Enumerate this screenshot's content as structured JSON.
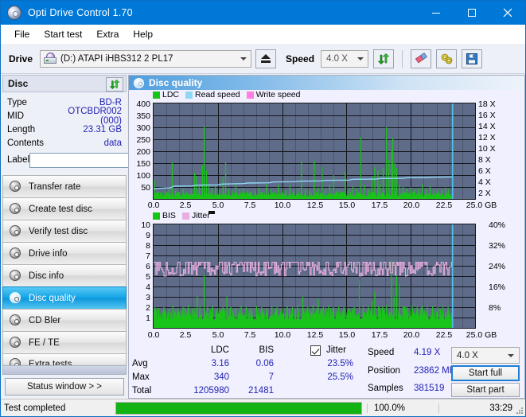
{
  "window": {
    "title": "Opti Drive Control 1.70",
    "icon": "disc-icon",
    "minimize": "minimize-icon",
    "maximize": "maximize-icon",
    "close": "close-icon"
  },
  "menubar": {
    "items": [
      {
        "label": "File"
      },
      {
        "label": "Start test"
      },
      {
        "label": "Extra"
      },
      {
        "label": "Help"
      }
    ]
  },
  "toolbar": {
    "drive_label": "Drive",
    "drive_value": "(D:)   ATAPI iHBS312   2 PL17",
    "eject_icon": "eject-icon",
    "speed_label": "Speed",
    "speed_value": "4.0 X",
    "refresh_icon": "refresh-icon",
    "eraser_icon": "eraser-icon",
    "settings_icon": "wrench-icon",
    "save_icon": "save-icon"
  },
  "disc_panel": {
    "title": "Disc",
    "refresh_icon": "refresh-icon",
    "fields": [
      {
        "key": "Type",
        "value": "BD-R"
      },
      {
        "key": "MID",
        "value": "OTCBDR002 (000)"
      },
      {
        "key": "Length",
        "value": "23.31 GB"
      },
      {
        "key": "Contents",
        "value": "data"
      }
    ],
    "label_key": "Label",
    "label_value": "",
    "label_button_icon": "cd-icon"
  },
  "nav": {
    "items": [
      {
        "label": "Transfer rate",
        "icon": "disc-transfer-icon",
        "active": false
      },
      {
        "label": "Create test disc",
        "icon": "disc-create-icon",
        "active": false
      },
      {
        "label": "Verify test disc",
        "icon": "disc-verify-icon",
        "active": false
      },
      {
        "label": "Drive info",
        "icon": "disc-drive-icon",
        "active": false
      },
      {
        "label": "Disc info",
        "icon": "disc-info-icon",
        "active": false
      },
      {
        "label": "Disc quality",
        "icon": "disc-quality-icon",
        "active": true
      },
      {
        "label": "CD Bler",
        "icon": "disc-bler-icon",
        "active": false
      },
      {
        "label": "FE / TE",
        "icon": "disc-fete-icon",
        "active": false
      },
      {
        "label": "Extra tests",
        "icon": "disc-extra-icon",
        "active": false
      }
    ],
    "status_window_label": "Status window > >"
  },
  "content": {
    "header_title": "Disc quality",
    "header_icon": "disc-quality-icon"
  },
  "statusbar": {
    "text": "Test completed",
    "percent_label": "100.0%",
    "percent_value": 100,
    "time": "33:29"
  },
  "stats": {
    "col_ldc": "LDC",
    "col_bis": "BIS",
    "jitter_label": "Jitter",
    "jitter_checked": true,
    "rows": [
      {
        "name": "Avg",
        "ldc": "3.16",
        "bis": "0.06",
        "jitter": "23.5%"
      },
      {
        "name": "Max",
        "ldc": "340",
        "bis": "7",
        "jitter": "25.5%"
      },
      {
        "name": "Total",
        "ldc": "1205980",
        "bis": "21481",
        "jitter": ""
      }
    ],
    "speed_key": "Speed",
    "speed_value": "4.19 X",
    "position_key": "Position",
    "position_value": "23862 MB",
    "samples_key": "Samples",
    "samples_value": "381519",
    "speed_select": "4.0 X",
    "start_full": "Start full",
    "start_part": "Start part"
  },
  "colors": {
    "accent": "#0078d7",
    "plot_bg": "#5e6c8a",
    "ldc_green": "#19c419",
    "bis_green": "#19c419",
    "read_speed": "#8fd8f5",
    "write_speed": "#ff7fe0",
    "jitter_pink": "#e8aede",
    "progress_green": "#12b312",
    "value_blue": "#2323b4"
  },
  "chart_data": [
    {
      "type": "area",
      "id": "ldc-chart",
      "title": "",
      "xlabel": "GB",
      "ylabel": "",
      "grid": true,
      "legend_position": "top-left",
      "legend": [
        {
          "label": "LDC",
          "color": "#19c419"
        },
        {
          "label": "Read speed",
          "color": "#8fd8f5"
        },
        {
          "label": "Write speed",
          "color": "#ff7fe0"
        }
      ],
      "xlim": [
        0,
        25.0
      ],
      "xticks": [
        "0.0",
        "2.5",
        "5.0",
        "7.5",
        "10.0",
        "12.5",
        "15.0",
        "17.5",
        "20.0",
        "22.5",
        "25.0 GB"
      ],
      "ylim": [
        0,
        400
      ],
      "yticks": [
        "50",
        "100",
        "150",
        "200",
        "250",
        "300",
        "350",
        "400"
      ],
      "y2lim": [
        0,
        18
      ],
      "y2ticks": [
        "2 X",
        "4 X",
        "6 X",
        "8 X",
        "10 X",
        "12 X",
        "14 X",
        "16 X",
        "18 X"
      ],
      "series": [
        {
          "name": "LDC",
          "color": "#19c419",
          "type": "area-spikes",
          "baseline": 22,
          "spikes": [
            [
              0.05,
              78
            ],
            [
              0.3,
              30
            ],
            [
              0.55,
              26
            ],
            [
              0.9,
              33
            ],
            [
              1.2,
              40
            ],
            [
              1.45,
              152
            ],
            [
              1.7,
              35
            ],
            [
              2.0,
              30
            ],
            [
              2.3,
              44
            ],
            [
              2.6,
              30
            ],
            [
              2.95,
              38
            ],
            [
              3.2,
              110
            ],
            [
              3.35,
              95
            ],
            [
              3.55,
              60
            ],
            [
              3.8,
              140
            ],
            [
              3.95,
              305
            ],
            [
              4.1,
              120
            ],
            [
              4.3,
              62
            ],
            [
              4.55,
              45
            ],
            [
              4.8,
              55
            ],
            [
              5.1,
              38
            ],
            [
              5.4,
              90
            ],
            [
              5.6,
              153
            ],
            [
              5.85,
              42
            ],
            [
              6.1,
              35
            ],
            [
              6.4,
              60
            ],
            [
              6.7,
              40
            ],
            [
              7.0,
              45
            ],
            [
              7.3,
              38
            ],
            [
              7.6,
              30
            ],
            [
              7.9,
              35
            ],
            [
              8.2,
              48
            ],
            [
              8.5,
              30
            ],
            [
              8.8,
              62
            ],
            [
              9.1,
              40
            ],
            [
              9.4,
              33
            ],
            [
              9.7,
              60
            ],
            [
              10.0,
              40
            ],
            [
              10.3,
              35
            ],
            [
              10.6,
              58
            ],
            [
              10.9,
              35
            ],
            [
              11.2,
              45
            ],
            [
              11.5,
              158
            ],
            [
              11.8,
              42
            ],
            [
              12.1,
              36
            ],
            [
              12.5,
              158
            ],
            [
              12.8,
              48
            ],
            [
              13.1,
              135
            ],
            [
              13.4,
              40
            ],
            [
              13.7,
              60
            ],
            [
              14.0,
              100
            ],
            [
              14.3,
              42
            ],
            [
              14.6,
              35
            ],
            [
              14.9,
              115
            ],
            [
              15.2,
              40
            ],
            [
              15.5,
              55
            ],
            [
              15.8,
              45
            ],
            [
              16.1,
              258
            ],
            [
              16.4,
              60
            ],
            [
              16.7,
              40
            ],
            [
              17.0,
              95
            ],
            [
              17.2,
              135
            ],
            [
              17.45,
              120
            ],
            [
              17.6,
              60
            ],
            [
              17.85,
              130
            ],
            [
              18.1,
              300
            ],
            [
              18.3,
              165
            ],
            [
              18.5,
              205
            ],
            [
              18.6,
              255
            ],
            [
              18.75,
              150
            ],
            [
              18.9,
              130
            ],
            [
              19.1,
              60
            ],
            [
              19.4,
              50
            ],
            [
              19.7,
              42
            ],
            [
              20.0,
              48
            ],
            [
              20.3,
              38
            ],
            [
              20.6,
              45
            ],
            [
              20.9,
              62
            ],
            [
              21.2,
              40
            ],
            [
              21.5,
              55
            ],
            [
              21.8,
              38
            ],
            [
              22.1,
              45
            ],
            [
              22.4,
              40
            ],
            [
              22.7,
              48
            ],
            [
              22.95,
              42
            ]
          ]
        },
        {
          "name": "Read speed",
          "color": "#8fd8f5",
          "type": "line",
          "points": [
            [
              0.0,
              1.9
            ],
            [
              0.3,
              2.0
            ],
            [
              1.3,
              2.1
            ],
            [
              1.6,
              2.4
            ],
            [
              3.0,
              2.45
            ],
            [
              3.3,
              2.6
            ],
            [
              5.0,
              2.65
            ],
            [
              5.3,
              2.8
            ],
            [
              7.0,
              2.9
            ],
            [
              7.3,
              3.0
            ],
            [
              9.0,
              3.05
            ],
            [
              9.3,
              3.2
            ],
            [
              11.0,
              3.25
            ],
            [
              11.3,
              3.35
            ],
            [
              13.0,
              3.4
            ],
            [
              13.3,
              3.5
            ],
            [
              15.2,
              3.55
            ],
            [
              15.5,
              3.7
            ],
            [
              17.3,
              3.75
            ],
            [
              17.6,
              3.85
            ],
            [
              19.4,
              3.9
            ],
            [
              19.7,
              4.0
            ],
            [
              21.4,
              4.05
            ],
            [
              21.6,
              4.1
            ],
            [
              23.2,
              4.15
            ]
          ]
        },
        {
          "name": "read-end-marker",
          "color": "#4fc3f0",
          "type": "vline",
          "x": 23.25
        }
      ]
    },
    {
      "type": "area",
      "id": "bis-jitter-chart",
      "title": "",
      "xlabel": "GB",
      "ylabel": "",
      "grid": true,
      "legend_position": "top-left",
      "legend": [
        {
          "label": "BIS",
          "color": "#19c419"
        },
        {
          "label": "Jitter",
          "color": "#e8aede"
        }
      ],
      "xlim": [
        0,
        25.0
      ],
      "xticks": [
        "0.0",
        "2.5",
        "5.0",
        "7.5",
        "10.0",
        "12.5",
        "15.0",
        "17.5",
        "20.0",
        "22.5",
        "25.0 GB"
      ],
      "ylim": [
        0,
        10
      ],
      "yticks": [
        "1",
        "2",
        "3",
        "4",
        "5",
        "6",
        "7",
        "8",
        "9",
        "10"
      ],
      "y2lim": [
        0,
        40
      ],
      "y2ticks": [
        "8%",
        "16%",
        "24%",
        "32%",
        "40%"
      ],
      "series": [
        {
          "name": "BIS",
          "color": "#19c419",
          "type": "area-spikes",
          "baseline": 1.5,
          "spikes": [
            [
              0.1,
              2.0
            ],
            [
              0.4,
              1.9
            ],
            [
              0.8,
              2.0
            ],
            [
              1.2,
              1.8
            ],
            [
              1.5,
              2.1
            ],
            [
              1.9,
              1.9
            ],
            [
              2.3,
              2.0
            ],
            [
              2.7,
              2.2
            ],
            [
              3.0,
              1.9
            ],
            [
              3.4,
              3.0
            ],
            [
              3.6,
              2.1
            ],
            [
              3.95,
              5.1
            ],
            [
              4.2,
              2.0
            ],
            [
              4.6,
              2.1
            ],
            [
              5.0,
              1.9
            ],
            [
              5.4,
              2.0
            ],
            [
              5.7,
              3.0
            ],
            [
              6.0,
              2.0
            ],
            [
              6.4,
              1.9
            ],
            [
              6.8,
              2.1
            ],
            [
              7.2,
              2.0
            ],
            [
              7.6,
              1.9
            ],
            [
              8.0,
              2.1
            ],
            [
              8.4,
              2.0
            ],
            [
              8.8,
              1.9
            ],
            [
              9.2,
              2.1
            ],
            [
              9.6,
              2.0
            ],
            [
              10.0,
              1.9
            ],
            [
              10.4,
              2.1
            ],
            [
              10.8,
              2.0
            ],
            [
              11.2,
              2.1
            ],
            [
              11.6,
              3.0
            ],
            [
              12.0,
              2.0
            ],
            [
              12.4,
              2.2
            ],
            [
              12.8,
              2.8
            ],
            [
              13.2,
              2.0
            ],
            [
              13.6,
              2.1
            ],
            [
              14.0,
              2.0
            ],
            [
              14.4,
              2.1
            ],
            [
              14.8,
              2.0
            ],
            [
              15.2,
              1.9
            ],
            [
              15.6,
              2.0
            ],
            [
              16.0,
              4.6
            ],
            [
              16.3,
              2.0
            ],
            [
              16.7,
              2.1
            ],
            [
              17.0,
              2.6
            ],
            [
              17.2,
              3.5
            ],
            [
              17.5,
              2.1
            ],
            [
              17.8,
              2.0
            ],
            [
              18.1,
              2.2
            ],
            [
              18.5,
              6.5
            ],
            [
              18.7,
              3.0
            ],
            [
              18.9,
              5.0
            ],
            [
              19.1,
              4.2
            ],
            [
              19.4,
              2.1
            ],
            [
              19.7,
              2.0
            ],
            [
              20.1,
              2.2
            ],
            [
              20.5,
              2.0
            ],
            [
              20.9,
              2.1
            ],
            [
              21.3,
              2.0
            ],
            [
              21.7,
              2.1
            ],
            [
              22.1,
              2.0
            ],
            [
              22.5,
              2.1
            ],
            [
              22.9,
              2.0
            ]
          ]
        },
        {
          "name": "Jitter",
          "color": "#e8aede",
          "type": "band",
          "top": 6.35,
          "bottom": 5.0,
          "avg": 5.9
        },
        {
          "name": "read-end-marker",
          "color": "#4fc3f0",
          "type": "vline",
          "x": 23.25
        }
      ]
    }
  ]
}
